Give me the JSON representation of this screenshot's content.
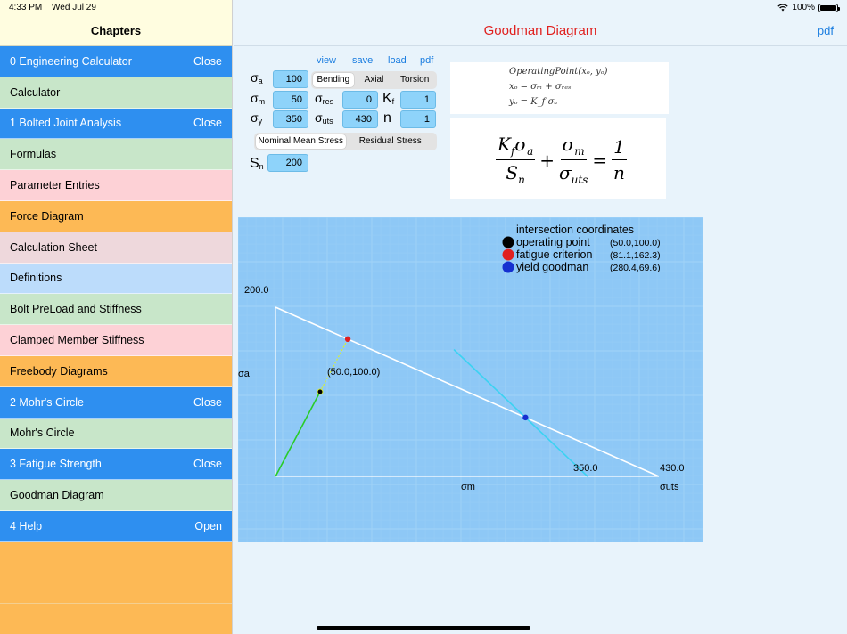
{
  "status_bar": {
    "time": "4:33 PM",
    "date": "Wed Jul 29",
    "battery": "100%"
  },
  "sidebar": {
    "title": "Chapters",
    "items": [
      {
        "label": "0 Engineering Calculator",
        "action": "Close",
        "kind": "section"
      },
      {
        "label": "Calculator",
        "color": "green"
      },
      {
        "label": "1 Bolted Joint Analysis",
        "action": "Close",
        "kind": "section"
      },
      {
        "label": "Formulas",
        "color": "green"
      },
      {
        "label": "Parameter Entries",
        "color": "pink"
      },
      {
        "label": "Force Diagram",
        "color": "orange"
      },
      {
        "label": "Calculation Sheet",
        "color": "mauve"
      },
      {
        "label": "Definitions",
        "color": "blue"
      },
      {
        "label": "Bolt PreLoad and Stiffness",
        "color": "green"
      },
      {
        "label": "Clamped Member Stiffness",
        "color": "pink"
      },
      {
        "label": "Freebody Diagrams",
        "color": "orange"
      },
      {
        "label": "2 Mohr's Circle",
        "action": "Close",
        "kind": "section"
      },
      {
        "label": "Mohr's Circle",
        "color": "green"
      },
      {
        "label": "3 Fatigue Strength",
        "action": "Close",
        "kind": "section"
      },
      {
        "label": "Goodman Diagram",
        "color": "green"
      },
      {
        "label": "4 Help",
        "action": "Open",
        "kind": "section"
      }
    ]
  },
  "nav": {
    "title": "Goodman Diagram",
    "pdf": "pdf"
  },
  "links": {
    "view": "view",
    "save": "save",
    "load": "load",
    "pdf": "pdf"
  },
  "params": {
    "sigma_a": {
      "label": "σ",
      "sub": "a",
      "value": "100"
    },
    "sigma_m": {
      "label": "σ",
      "sub": "m",
      "value": "50"
    },
    "sigma_y": {
      "label": "σ",
      "sub": "y",
      "value": "350"
    },
    "sigma_res": {
      "label": "σ",
      "sub": "res",
      "value": "0"
    },
    "sigma_uts": {
      "label": "σ",
      "sub": "uts",
      "value": "430"
    },
    "kf": {
      "label": "K",
      "sub": "f",
      "value": "1"
    },
    "n": {
      "label": "n",
      "value": "1"
    },
    "sn": {
      "label": "S",
      "sub": "n",
      "value": "200"
    }
  },
  "load_type": {
    "options": [
      "Bending",
      "Axial",
      "Torsion"
    ],
    "selected": "Bending"
  },
  "stress_mode": {
    "options": [
      "Nominal Mean Stress",
      "Residual Stress"
    ],
    "selected": "Nominal Mean Stress"
  },
  "formula1": {
    "line1": "OperatingPoint(xₒ, yₒ)",
    "line2": "xₒ = σₘ + σᵣₑₛ",
    "line3": "yₒ = K_f σₐ"
  },
  "formula2": {
    "t1_num": "K",
    "t1_num_sub": "f",
    "t1_num_sym": "σ",
    "t1_num_sym_sub": "a",
    "t1_den": "S",
    "t1_den_sub": "n",
    "plus": "+",
    "t2_num": "σ",
    "t2_num_sub": "m",
    "t2_den": "σ",
    "t2_den_sub": "uts",
    "eq": "=",
    "rhs_num": "1",
    "rhs_den": "n"
  },
  "chart_data": {
    "type": "scatter",
    "title": "intersection coordinates",
    "xlabel": "σm",
    "ylabel": "σa",
    "xlim": [
      0,
      430
    ],
    "ylim": [
      0,
      200
    ],
    "grid": true,
    "legend_position": "top-right",
    "lines": [
      {
        "name": "goodman line",
        "points": [
          [
            0,
            200
          ],
          [
            430,
            0
          ]
        ],
        "color": "#ffffff"
      },
      {
        "name": "yield line",
        "points": [
          [
            350,
            0
          ],
          [
            200,
            150
          ]
        ],
        "color": "#3cd2f2"
      },
      {
        "name": "load line",
        "points": [
          [
            0,
            0
          ],
          [
            50,
            100
          ]
        ],
        "color": "#29cc29"
      },
      {
        "name": "load line extension",
        "points": [
          [
            50,
            100
          ],
          [
            81.1,
            162.3
          ]
        ],
        "color": "#d6ee3a",
        "dashed": true
      }
    ],
    "points": [
      {
        "name": "operating point",
        "x": 50.0,
        "y": 100.0,
        "coords": "(50.0,100.0)",
        "color": "#000000"
      },
      {
        "name": "fatigue criterion",
        "x": 81.1,
        "y": 162.3,
        "coords": "(81.1,162.3)",
        "color": "#e02020"
      },
      {
        "name": "yield goodman",
        "x": 280.4,
        "y": 69.6,
        "coords": "(280.4,69.6)",
        "color": "#1530d0"
      }
    ],
    "annotations": {
      "y_max_label": "200.0",
      "yield_label": "350.0",
      "uts_label": "430.0",
      "uts_axis_label": "σuts",
      "op_label": "(50.0,100.0)"
    }
  },
  "colors": {
    "section": "#2e8ff0",
    "accent": "#1a7de0",
    "title": "#e0201e",
    "chart_bg": "#8ec8f6",
    "field": "#8ed3fa"
  }
}
